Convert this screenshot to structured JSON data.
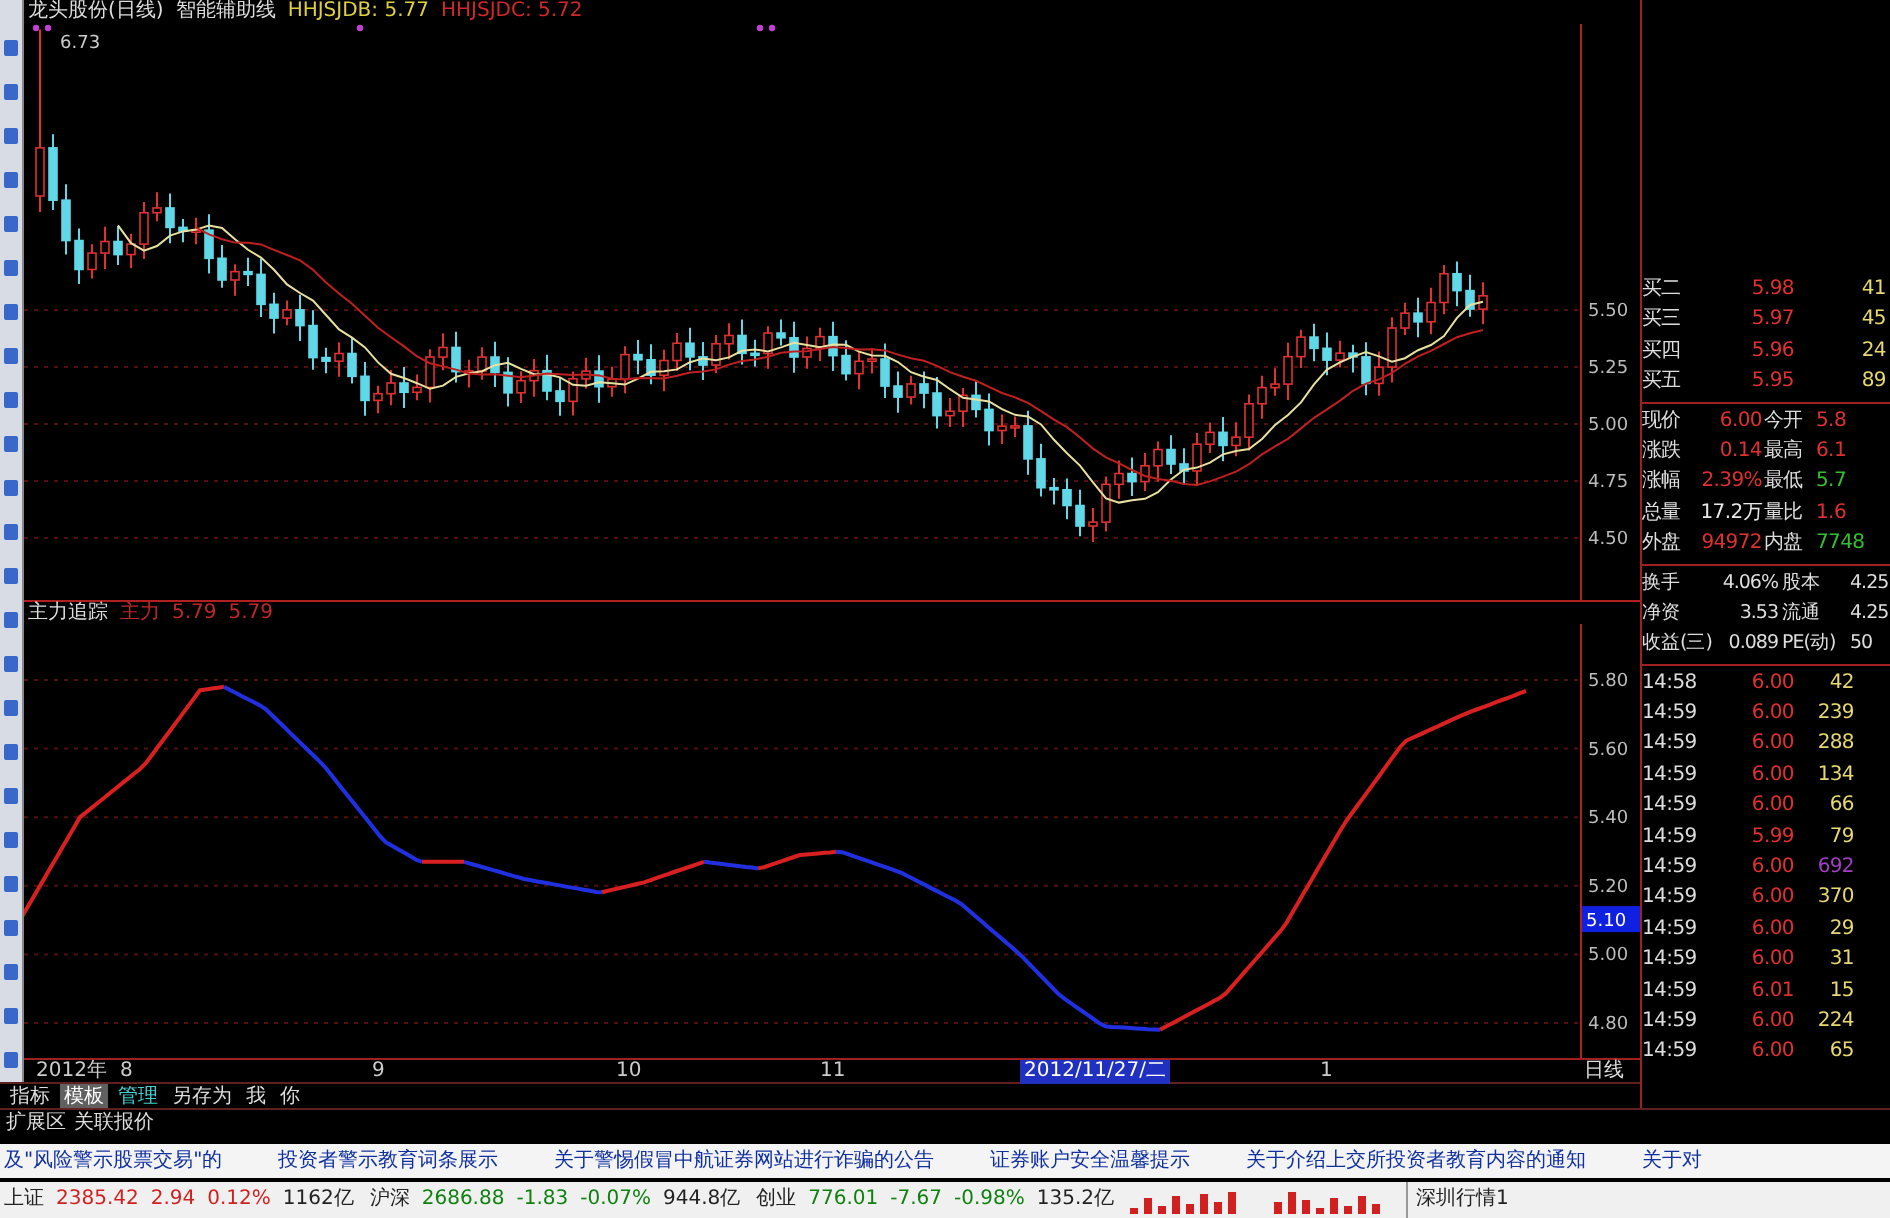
{
  "chart_header": {
    "stock": "龙头股份(日线)",
    "indicator": "智能辅助线",
    "lines": [
      {
        "label": "HHJSJDB: 5.77",
        "color": "#e0d040"
      },
      {
        "label": "HHJSJDC: 5.72",
        "color": "#d02828"
      }
    ]
  },
  "price_chart": {
    "peak_label": "6.73",
    "axis": [
      "5.50",
      "5.25",
      "5.00",
      "4.75",
      "4.50"
    ]
  },
  "indicator_header": {
    "name": "主力追踪",
    "values": [
      "主力",
      "5.79",
      "5.79"
    ]
  },
  "indicator_chart": {
    "axis": [
      "5.80",
      "5.60",
      "5.40",
      "5.20",
      "5.00",
      "4.80"
    ],
    "cursor_value": "5.10"
  },
  "date_axis": [
    {
      "label": "2012年",
      "selected": false
    },
    {
      "label": "8",
      "selected": false
    },
    {
      "label": "9",
      "selected": false
    },
    {
      "label": "10",
      "selected": false
    },
    {
      "label": "11",
      "selected": false
    },
    {
      "label": "2012/11/27/二",
      "selected": true
    },
    {
      "label": "1",
      "selected": false
    }
  ],
  "period_label": "日线",
  "quote_panel": {
    "bids": [
      {
        "label": "买二",
        "price": "5.98",
        "volume": "41"
      },
      {
        "label": "买三",
        "price": "5.97",
        "volume": "45"
      },
      {
        "label": "买四",
        "price": "5.96",
        "volume": "24"
      },
      {
        "label": "买五",
        "price": "5.95",
        "volume": "89"
      }
    ],
    "stats": [
      [
        {
          "label": "现价",
          "value": "6.00",
          "color": "#e03030"
        },
        {
          "label": "今开",
          "value": "5.8",
          "color": "#e03030"
        }
      ],
      [
        {
          "label": "涨跌",
          "value": "0.14",
          "color": "#e03030"
        },
        {
          "label": "最高",
          "value": "6.1",
          "color": "#e03030"
        }
      ],
      [
        {
          "label": "涨幅",
          "value": "2.39%",
          "color": "#e03030"
        },
        {
          "label": "最低",
          "value": "5.7",
          "color": "#30c030"
        }
      ],
      [
        {
          "label": "总量",
          "value": "17.2万",
          "color": "#e8e8e8"
        },
        {
          "label": "量比",
          "value": "1.6",
          "color": "#e03030"
        }
      ],
      [
        {
          "label": "外盘",
          "value": "94972",
          "color": "#e03030"
        },
        {
          "label": "内盘",
          "value": "7748",
          "color": "#30c030"
        }
      ]
    ],
    "finance": [
      {
        "label": "换手",
        "value": "4.06%",
        "label2": "股本",
        "value2": "4.25"
      },
      {
        "label": "净资",
        "value": "3.53",
        "label2": "流通",
        "value2": "4.25"
      },
      {
        "label": "收益(三)",
        "value": "0.089",
        "label2": "PE(动)",
        "value2": "50"
      }
    ],
    "ticks": [
      {
        "time": "14:58",
        "price": "6.00",
        "volume": "42",
        "color": "#e8d870"
      },
      {
        "time": "14:59",
        "price": "6.00",
        "volume": "239",
        "color": "#e8d870"
      },
      {
        "time": "14:59",
        "price": "6.00",
        "volume": "288",
        "color": "#e8d870"
      },
      {
        "time": "14:59",
        "price": "6.00",
        "volume": "134",
        "color": "#e8d870"
      },
      {
        "time": "14:59",
        "price": "6.00",
        "volume": "66",
        "color": "#e8d870"
      },
      {
        "time": "14:59",
        "price": "5.99",
        "volume": "79",
        "color": "#e8d870"
      },
      {
        "time": "14:59",
        "price": "6.00",
        "volume": "692",
        "color": "#a040c0"
      },
      {
        "time": "14:59",
        "price": "6.00",
        "volume": "370",
        "color": "#e8d870"
      },
      {
        "time": "14:59",
        "price": "6.00",
        "volume": "29",
        "color": "#e8d870"
      },
      {
        "time": "14:59",
        "price": "6.00",
        "volume": "31",
        "color": "#e8d870"
      },
      {
        "time": "14:59",
        "price": "6.01",
        "volume": "15",
        "color": "#e8d870"
      },
      {
        "time": "14:59",
        "price": "6.00",
        "volume": "224",
        "color": "#e8d870"
      },
      {
        "time": "14:59",
        "price": "6.00",
        "volume": "65",
        "color": "#e8d870"
      }
    ]
  },
  "formula_tabs": [
    {
      "label": "指标",
      "selected": false
    },
    {
      "label": "模板",
      "selected": true
    },
    {
      "label": "管理",
      "selected": false
    },
    {
      "label": "另存为",
      "selected": false
    },
    {
      "label": "我",
      "selected": false
    },
    {
      "label": "你",
      "selected": false
    }
  ],
  "extension_tabs": [
    "扩展区",
    "关联报价"
  ],
  "news": [
    "及\"风险警示股票交易\"的",
    "投资者警示教育词条展示",
    "关于警惕假冒中航证券网站进行诈骗的公告",
    "证券账户安全温馨提示",
    "关于介绍上交所投资者教育内容的通知",
    "关于对"
  ],
  "status_bar": {
    "indices": [
      {
        "name": "上证",
        "value": "2385.42",
        "change": "2.94",
        "percent": "0.12%",
        "amount": "1162亿",
        "color": "#d02020"
      },
      {
        "name": "沪深",
        "value": "2686.88",
        "change": "-1.83",
        "percent": "-0.07%",
        "amount": "944.8亿",
        "color": "#108010"
      },
      {
        "name": "创业",
        "value": "776.01",
        "change": "-7.67",
        "percent": "-0.98%",
        "amount": "135.2亿",
        "color": "#108010"
      }
    ],
    "market": "深圳行情1"
  }
}
